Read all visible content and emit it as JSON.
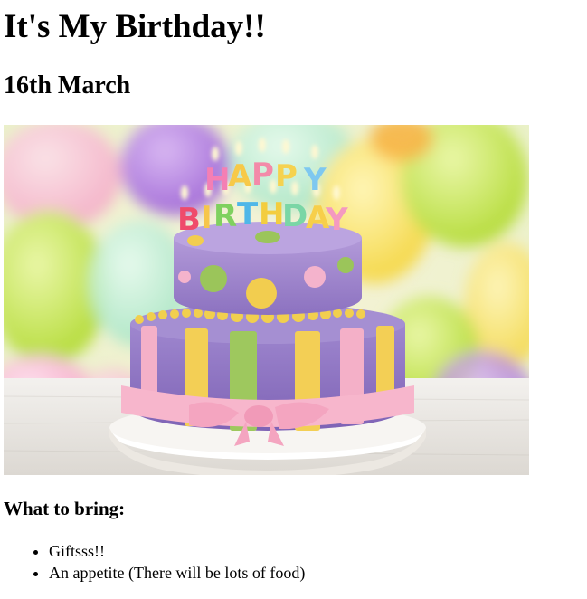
{
  "heading": {
    "title": "It's My Birthday!!",
    "date": "16th March"
  },
  "photo": {
    "candle_text": "HAPPY BIRTHDAY",
    "accent_colors": {
      "lavender": "#9b87c8",
      "lime": "#bfe36a",
      "yellow": "#f3d25a",
      "pink": "#f7b6c8",
      "green": "#8fbf6a",
      "plate": "#ffffff"
    }
  },
  "section": {
    "title": "What to bring:",
    "items": [
      "Giftsss!!",
      "An appetite (There will be lots of food)"
    ]
  }
}
